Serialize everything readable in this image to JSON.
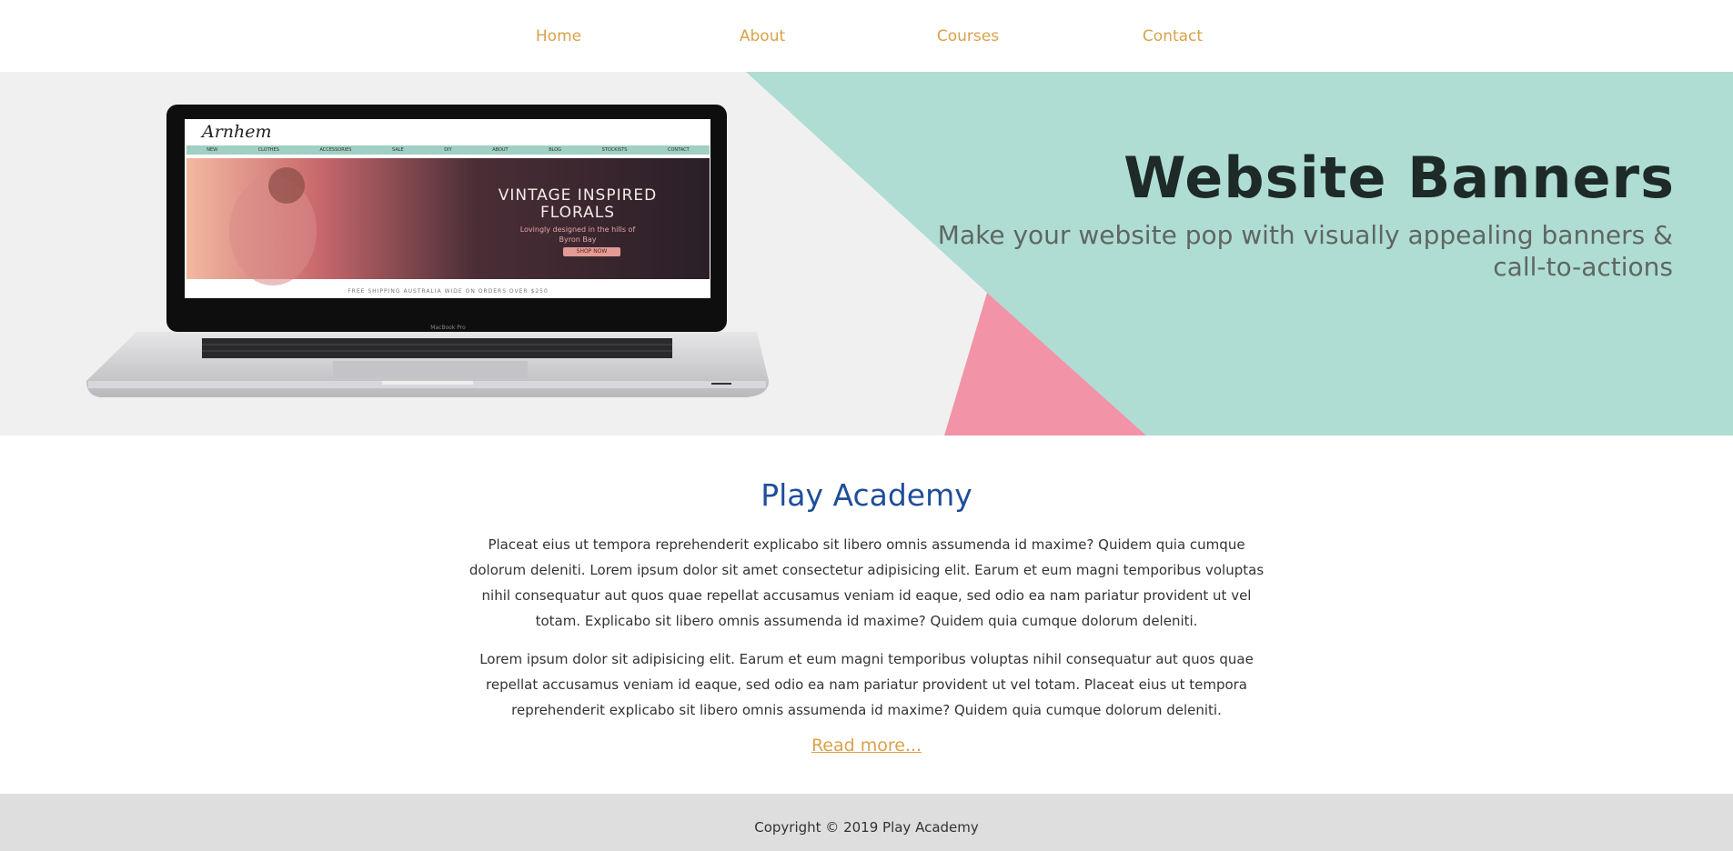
{
  "nav": {
    "items": [
      {
        "label": "Home"
      },
      {
        "label": "About"
      },
      {
        "label": "Courses"
      },
      {
        "label": "Contact"
      }
    ]
  },
  "hero": {
    "title": "Website Banners",
    "subtitle": "Make your website pop with visually appealing banners & call-to-actions",
    "screen": {
      "logo": "Arnhem",
      "menu": [
        "NEW",
        "CLOTHES",
        "ACCESSORIES",
        "SALE",
        "DIY",
        "ABOUT",
        "BLOG",
        "STOCKISTS",
        "CONTACT"
      ],
      "headline": "VINTAGE INSPIRED FLORALS",
      "tagline": "Lovingly designed in the hills of Byron Bay",
      "button": "SHOP NOW",
      "shipping": "FREE SHIPPING AUSTRALIA WIDE ON ORDERS OVER $250",
      "brand": "MacBook Pro"
    },
    "colors": {
      "mint": "#afddd3",
      "pink": "#f293a8",
      "background": "#f0f0f0"
    }
  },
  "main": {
    "title": "Play Academy",
    "paragraph1": "Placeat eius ut tempora reprehenderit explicabo sit libero omnis assumenda id maxime? Quidem quia cumque dolorum deleniti. Lorem ipsum dolor sit amet consectetur adipisicing elit. Earum et eum magni temporibus voluptas nihil consequatur aut quos quae repellat accusamus veniam id eaque, sed odio ea nam pariatur provident ut vel totam. Explicabo sit libero omnis assumenda id maxime? Quidem quia cumque dolorum deleniti.",
    "paragraph2": "Lorem ipsum dolor sit adipisicing elit. Earum et eum magni temporibus voluptas nihil consequatur aut quos quae repellat accusamus veniam id eaque, sed odio ea nam pariatur provident ut vel totam. Placeat eius ut tempora reprehenderit explicabo sit libero omnis assumenda id maxime? Quidem quia cumque dolorum deleniti.",
    "read_more": "Read more..."
  },
  "footer": {
    "copyright": "Copyright © 2019 Play Academy"
  },
  "colors": {
    "nav_link": "#d9a24a",
    "title": "#1f4e9a",
    "footer_bg": "#dedede"
  }
}
